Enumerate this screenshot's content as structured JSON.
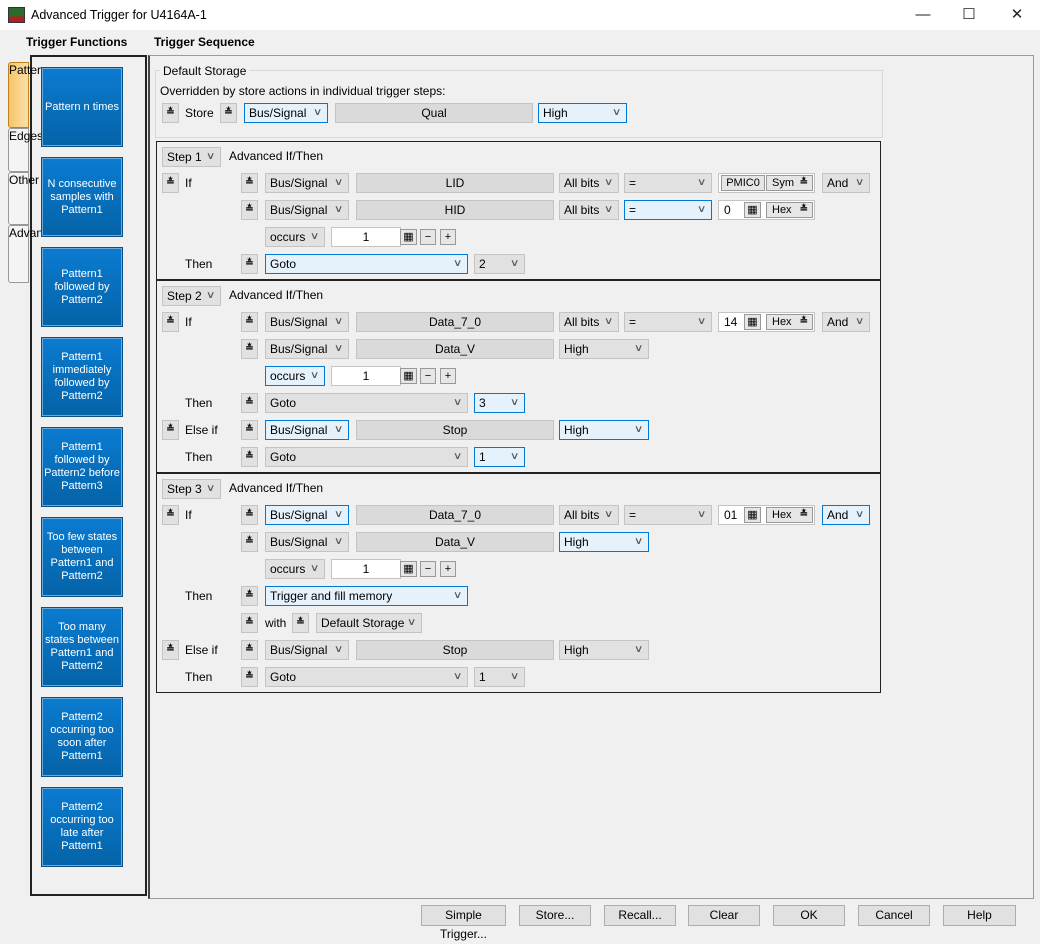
{
  "window": {
    "title": "Advanced Trigger for U4164A-1",
    "minimize": "—",
    "maximize": "☐",
    "close": "✕"
  },
  "left": {
    "header": "Trigger Functions",
    "tabs": [
      "Patterns",
      "Edges",
      "Other",
      "Advanced"
    ],
    "active_tab": "Patterns",
    "functions": [
      "Pattern n times",
      "N consecutive samples with Pattern1",
      "Pattern1 followed by Pattern2",
      "Pattern1 immediately followed by Pattern2",
      "Pattern1 followed by Pattern2 before Pattern3",
      "Too few states between Pattern1 and Pattern2",
      "Too many states between Pattern1 and Pattern2",
      "Pattern2 occurring too soon after Pattern1",
      "Pattern2 occurring too late after Pattern1"
    ]
  },
  "sequence": {
    "header": "Trigger Sequence",
    "default_storage": {
      "title": "Default Storage",
      "note": "Overridden by store actions in individual trigger steps:",
      "store_label": "Store",
      "signal_type": "Bus/Signal",
      "signal": "Qual",
      "level": "High"
    },
    "steps": [
      {
        "step": "Step 1",
        "mode": "Advanced If/Then",
        "rows": [
          {
            "label": "If",
            "lead": true,
            "controls": [
              {
                "role": "chev"
              },
              {
                "role": "signal_type",
                "text": "Bus/Signal"
              },
              {
                "role": "signal",
                "text": "LID"
              },
              {
                "role": "bits",
                "text": "All bits"
              },
              {
                "role": "op",
                "text": "="
              },
              {
                "role": "value",
                "text": "PMIC0",
                "fmt": "Sym",
                "sym": true
              },
              {
                "role": "logic",
                "text": "And"
              }
            ]
          },
          {
            "label": "",
            "controls": [
              {
                "role": "chev"
              },
              {
                "role": "signal_type",
                "text": "Bus/Signal"
              },
              {
                "role": "signal",
                "text": "HID"
              },
              {
                "role": "bits",
                "text": "All bits"
              },
              {
                "role": "op",
                "text": "=",
                "focus": true
              },
              {
                "role": "value",
                "text": "0",
                "fmt": "Hex"
              }
            ]
          },
          {
            "label": "",
            "controls": [
              {
                "role": "occurs",
                "text": "occurs"
              },
              {
                "role": "count",
                "text": "1"
              }
            ]
          },
          {
            "label": "Then",
            "controls": [
              {
                "role": "chev"
              },
              {
                "role": "action",
                "text": "Goto",
                "focus": true
              },
              {
                "role": "goto",
                "text": "2"
              }
            ]
          }
        ]
      },
      {
        "step": "Step 2",
        "mode": "Advanced If/Then",
        "rows": [
          {
            "label": "If",
            "lead": true,
            "controls": [
              {
                "role": "chev"
              },
              {
                "role": "signal_type",
                "text": "Bus/Signal"
              },
              {
                "role": "signal",
                "text": "Data_7_0"
              },
              {
                "role": "bits",
                "text": "All bits"
              },
              {
                "role": "op",
                "text": "="
              },
              {
                "role": "value",
                "text": "14",
                "fmt": "Hex"
              },
              {
                "role": "logic",
                "text": "And"
              }
            ]
          },
          {
            "label": "",
            "controls": [
              {
                "role": "chev"
              },
              {
                "role": "signal_type",
                "text": "Bus/Signal"
              },
              {
                "role": "signal",
                "text": "Data_V"
              },
              {
                "role": "level",
                "text": "High"
              }
            ]
          },
          {
            "label": "",
            "controls": [
              {
                "role": "occurs",
                "text": "occurs",
                "focus": true
              },
              {
                "role": "count",
                "text": "1"
              }
            ]
          },
          {
            "label": "Then",
            "controls": [
              {
                "role": "chev"
              },
              {
                "role": "action",
                "text": "Goto"
              },
              {
                "role": "goto",
                "text": "3",
                "focus": true
              }
            ]
          },
          {
            "label": "Else if",
            "lead": true,
            "controls": [
              {
                "role": "chev"
              },
              {
                "role": "signal_type",
                "text": "Bus/Signal",
                "focus": true
              },
              {
                "role": "signal",
                "text": "Stop"
              },
              {
                "role": "level",
                "text": "High",
                "focus": true
              }
            ]
          },
          {
            "label": "Then",
            "controls": [
              {
                "role": "chev"
              },
              {
                "role": "action",
                "text": "Goto"
              },
              {
                "role": "goto",
                "text": "1",
                "focus": true
              }
            ]
          }
        ]
      },
      {
        "step": "Step 3",
        "mode": "Advanced If/Then",
        "rows": [
          {
            "label": "If",
            "lead": true,
            "controls": [
              {
                "role": "chev"
              },
              {
                "role": "signal_type",
                "text": "Bus/Signal",
                "focus": true
              },
              {
                "role": "signal",
                "text": "Data_7_0"
              },
              {
                "role": "bits",
                "text": "All bits"
              },
              {
                "role": "op",
                "text": "="
              },
              {
                "role": "value",
                "text": "01",
                "fmt": "Hex"
              },
              {
                "role": "logic",
                "text": "And",
                "focus": true
              }
            ]
          },
          {
            "label": "",
            "controls": [
              {
                "role": "chev"
              },
              {
                "role": "signal_type",
                "text": "Bus/Signal"
              },
              {
                "role": "signal",
                "text": "Data_V"
              },
              {
                "role": "level",
                "text": "High",
                "focus": true
              }
            ]
          },
          {
            "label": "",
            "controls": [
              {
                "role": "occurs",
                "text": "occurs"
              },
              {
                "role": "count",
                "text": "1"
              }
            ]
          },
          {
            "label": "Then",
            "controls": [
              {
                "role": "chev"
              },
              {
                "role": "action",
                "text": "Trigger and fill memory",
                "focus": true
              }
            ]
          },
          {
            "label": "",
            "controls": [
              {
                "role": "chev"
              },
              {
                "role": "with",
                "text": "with"
              },
              {
                "role": "chev2"
              },
              {
                "role": "storage",
                "text": "Default Storage"
              }
            ]
          },
          {
            "label": "Else if",
            "lead": true,
            "controls": [
              {
                "role": "chev"
              },
              {
                "role": "signal_type",
                "text": "Bus/Signal"
              },
              {
                "role": "signal",
                "text": "Stop"
              },
              {
                "role": "level",
                "text": "High"
              }
            ]
          },
          {
            "label": "Then",
            "controls": [
              {
                "role": "chev"
              },
              {
                "role": "action",
                "text": "Goto"
              },
              {
                "role": "goto",
                "text": "1"
              }
            ]
          }
        ]
      }
    ]
  },
  "buttons": [
    "Simple Trigger...",
    "Store...",
    "Recall...",
    "Clear",
    "OK",
    "Cancel",
    "Help"
  ]
}
